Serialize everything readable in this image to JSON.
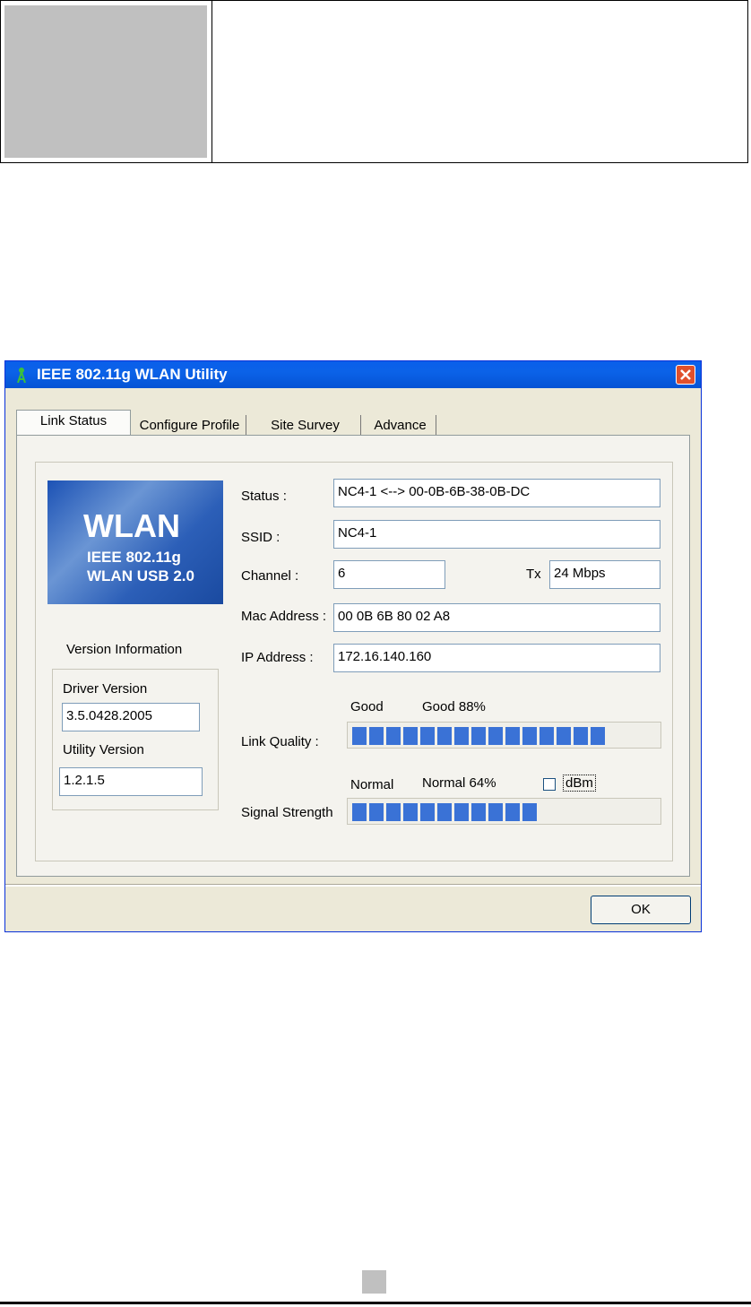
{
  "window": {
    "title": "IEEE 802.11g WLAN Utility"
  },
  "tabs": [
    "Link Status",
    "Configure Profile",
    "Site Survey",
    "Advance"
  ],
  "logo": {
    "line1": "WLAN",
    "line2": "IEEE 802.11g",
    "line3": "WLAN USB 2.0"
  },
  "version": {
    "heading": "Version Information",
    "driver_label": "Driver Version",
    "driver_value": "3.5.0428.2005",
    "utility_label": "Utility Version",
    "utility_value": "1.2.1.5"
  },
  "status": {
    "status_label": "Status :",
    "status_value": "NC4-1 <--> 00-0B-6B-38-0B-DC",
    "ssid_label": "SSID :",
    "ssid_value": "NC4-1",
    "channel_label": "Channel :",
    "channel_value": "6",
    "tx_label": "Tx",
    "tx_value": "24 Mbps",
    "mac_label": "Mac Address :",
    "mac_value": "00 0B 6B 80 02 A8",
    "ip_label": "IP Address :",
    "ip_value": "172.16.140.160"
  },
  "link_quality": {
    "label": "Link Quality :",
    "word": "Good",
    "text": "Good 88%",
    "percent": 88
  },
  "signal_strength": {
    "label": "Signal Strength",
    "word": "Normal",
    "text": "Normal 64%",
    "percent": 64,
    "dbm_label": "dBm",
    "dbm_checked": false
  },
  "buttons": {
    "ok": "OK"
  },
  "colors": {
    "titlebar": "#0a5fea",
    "bar_fill": "#3a72d6",
    "close": "#e0502c"
  }
}
